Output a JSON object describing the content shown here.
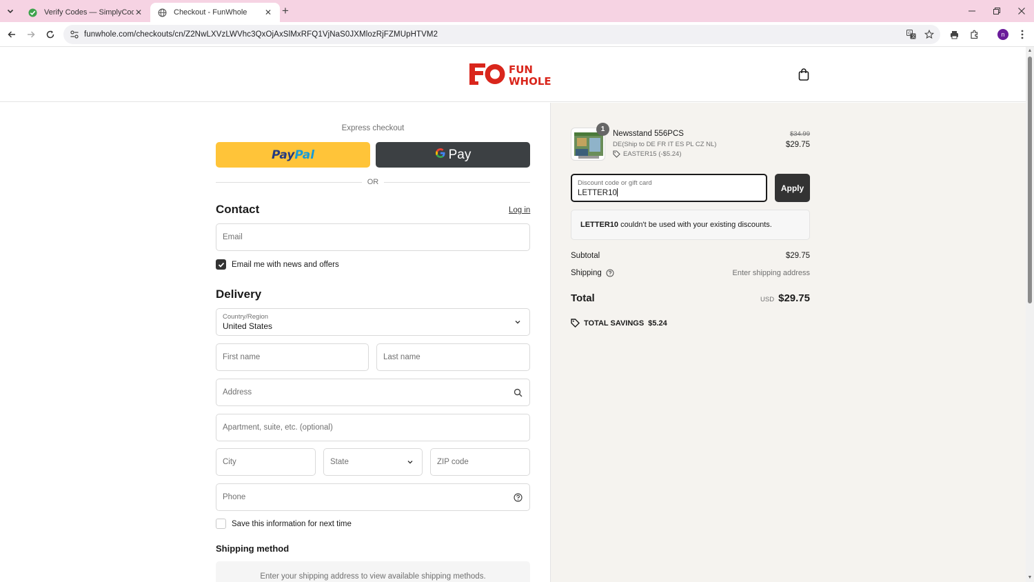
{
  "browser": {
    "tabs": [
      {
        "title": "Verify Codes — SimplyCodes",
        "active": false
      },
      {
        "title": "Checkout - FunWhole",
        "active": true
      }
    ],
    "url": "funwhole.com/checkouts/cn/Z2NwLXVzLWVhc3QxOjAxSlMxRFQ1VjNaS0JXMlozRjFZMUpHTVM2",
    "avatar_letter": "n"
  },
  "header": {
    "logo_text_1": "FUN",
    "logo_text_2": "WHOLE"
  },
  "express": {
    "label": "Express checkout",
    "paypal_1": "Pay",
    "paypal_2": "Pal",
    "gpay_g": "G",
    "gpay_label": "Pay",
    "or": "OR"
  },
  "contact": {
    "title": "Contact",
    "login": "Log in",
    "email_placeholder": "Email",
    "newsletter": "Email me with news and offers",
    "newsletter_checked": true
  },
  "delivery": {
    "title": "Delivery",
    "country_label": "Country/Region",
    "country_value": "United States",
    "first_name": "First name",
    "last_name": "Last name",
    "address": "Address",
    "apartment": "Apartment, suite, etc. (optional)",
    "city": "City",
    "state": "State",
    "zip": "ZIP code",
    "phone": "Phone",
    "save_info": "Save this information for next time",
    "save_checked": false
  },
  "shipping_method": {
    "title": "Shipping method",
    "message": "Enter your shipping address to view available shipping methods."
  },
  "summary": {
    "product": {
      "quantity": "1",
      "name": "Newsstand 556PCS",
      "variant": "DE(Ship to DE FR IT ES PL CZ NL)",
      "discount": "EASTER15 (-$5.24)",
      "original_price": "$34.99",
      "price": "$29.75"
    },
    "discount_label": "Discount code or gift card",
    "discount_value": "LETTER10",
    "apply": "Apply",
    "notice_code": "LETTER10",
    "notice_text": " couldn't be used with your existing discounts.",
    "subtotal_label": "Subtotal",
    "subtotal_value": "$29.75",
    "shipping_label": "Shipping",
    "shipping_value": "Enter shipping address",
    "total_label": "Total",
    "total_currency": "USD",
    "total_value": "$29.75",
    "savings_label": "TOTAL SAVINGS",
    "savings_value": "$5.24"
  },
  "colors": {
    "paypal_yellow": "#ffc439",
    "gpay_dark": "#3c4043",
    "brand_red": "#d9261c",
    "tab_bar": "#f6d3e3",
    "summary_bg": "#f5f3ef"
  }
}
